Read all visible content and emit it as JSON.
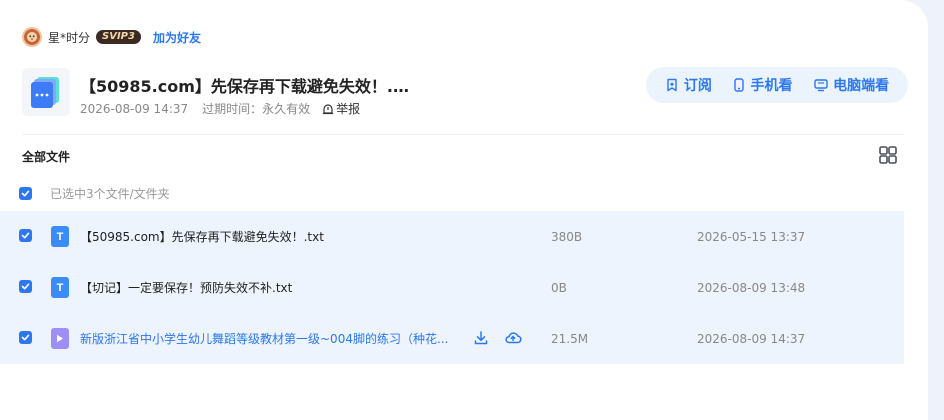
{
  "sharer": {
    "name": "星*时分",
    "vip": "SVIP3",
    "add_friend": "加为好友"
  },
  "share": {
    "title": "【50985.com】先保存再下载避免失效！.…",
    "date": "2026-08-09 14:37",
    "expiry_label": "过期时间：",
    "expiry_value": "永久有效",
    "report": "举报"
  },
  "actions": {
    "subscribe": "订阅",
    "mobile": "手机看",
    "pc": "电脑端看"
  },
  "list": {
    "heading": "全部文件",
    "selection_text": "已选中3个文件/文件夹",
    "files": [
      {
        "name": "【50985.com】先保存再下载避免失效！.txt",
        "size": "380B",
        "date": "2026-05-15 13:37",
        "type": "txt",
        "icon_letter": "T"
      },
      {
        "name": "【切记】一定要保存！预防失效不补.txt",
        "size": "0B",
        "date": "2026-08-09 13:48",
        "type": "txt",
        "icon_letter": "T"
      },
      {
        "name": "新版浙江省中小学生幼儿舞蹈等级教材第一级~004脚的练习（种花...",
        "size": "21.5M",
        "date": "2026-08-09 14:37",
        "type": "video"
      }
    ]
  },
  "colors": {
    "accent": "#2b78f0",
    "row_selected": "#edf4fd",
    "txt_icon": "#3b8cf6",
    "video_icon": "#9d8ff5"
  }
}
